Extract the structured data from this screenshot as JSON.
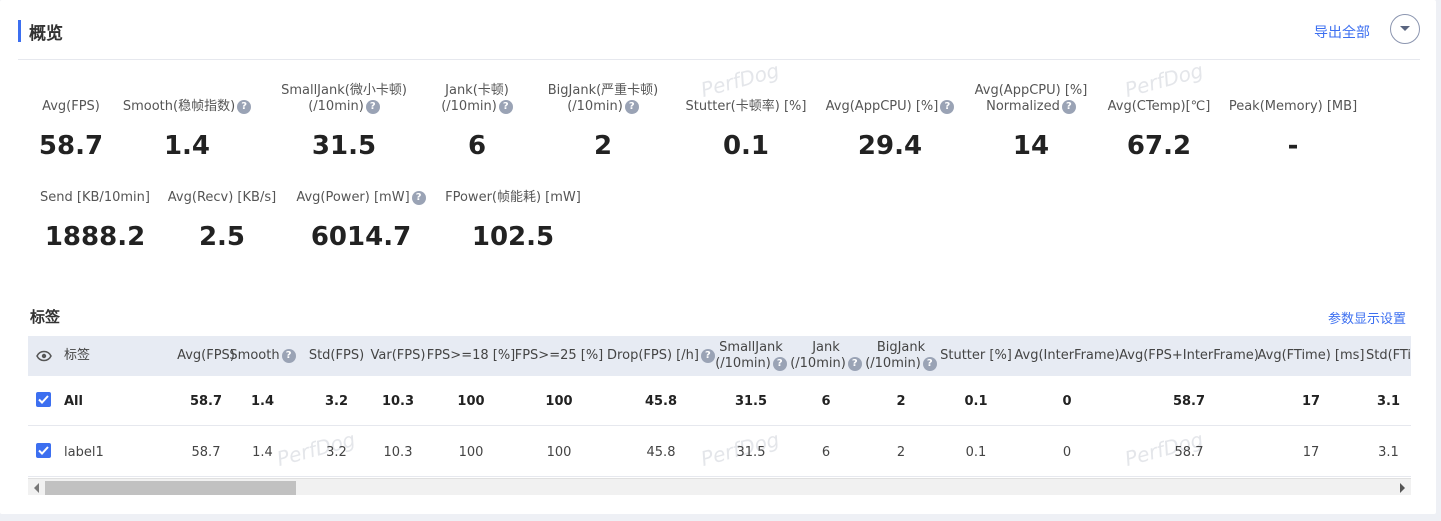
{
  "header": {
    "title": "概览",
    "export_label": "导出全部",
    "collapse_icon": "chevron-down-icon"
  },
  "watermark": "PerfDog",
  "metrics_row1": [
    {
      "l1": "",
      "l2": "Avg(FPS)",
      "help": false,
      "value": "58.7"
    },
    {
      "l1": "",
      "l2": "Smooth(稳帧指数)",
      "help": true,
      "value": "1.4"
    },
    {
      "l1": "SmallJank(微小卡顿)",
      "l2": "(/10min)",
      "help": true,
      "value": "31.5"
    },
    {
      "l1": "Jank(卡顿)",
      "l2": "(/10min)",
      "help": true,
      "value": "6"
    },
    {
      "l1": "BigJank(严重卡顿)",
      "l2": "(/10min)",
      "help": true,
      "value": "2"
    },
    {
      "l1": "",
      "l2": "Stutter(卡顿率) [%]",
      "help": false,
      "value": "0.1"
    },
    {
      "l1": "",
      "l2": "Avg(AppCPU) [%]",
      "help": true,
      "value": "29.4"
    },
    {
      "l1": "Avg(AppCPU) [%]",
      "l2": "Normalized",
      "help": true,
      "value": "14"
    },
    {
      "l1": "",
      "l2": "Avg(CTemp)[℃]",
      "help": false,
      "value": "67.2"
    },
    {
      "l1": "",
      "l2": "Peak(Memory) [MB]",
      "help": false,
      "value": "-"
    }
  ],
  "metrics_row2": [
    {
      "l1": "",
      "l2": "Send [KB/10min]",
      "help": false,
      "value": "1888.2"
    },
    {
      "l1": "",
      "l2": "Avg(Recv) [KB/s]",
      "help": false,
      "value": "2.5"
    },
    {
      "l1": "",
      "l2": "Avg(Power) [mW]",
      "help": true,
      "value": "6014.7"
    },
    {
      "l1": "",
      "l2": "FPower(帧能耗) [mW]",
      "help": false,
      "value": "102.5"
    }
  ],
  "labels_section": {
    "title": "标签",
    "settings_label": "参数显示设置"
  },
  "table": {
    "columns": [
      {
        "l1": "标签",
        "l2": "",
        "help": false
      },
      {
        "l1": "Avg(FPS)",
        "l2": "",
        "help": false
      },
      {
        "l1": "Smooth",
        "l2": "",
        "help": true
      },
      {
        "l1": "Std(FPS)",
        "l2": "",
        "help": false
      },
      {
        "l1": "Var(FPS)",
        "l2": "",
        "help": false
      },
      {
        "l1": "FPS>=18 [%]",
        "l2": "",
        "help": false
      },
      {
        "l1": "FPS>=25 [%]",
        "l2": "",
        "help": false
      },
      {
        "l1": "Drop(FPS) [/h]",
        "l2": "",
        "help": true
      },
      {
        "l1": "SmallJank",
        "l2": "(/10min)",
        "help": true
      },
      {
        "l1": "Jank",
        "l2": "(/10min)",
        "help": true
      },
      {
        "l1": "BigJank",
        "l2": "(/10min)",
        "help": true
      },
      {
        "l1": "Stutter [%]",
        "l2": "",
        "help": false
      },
      {
        "l1": "Avg(InterFrame)",
        "l2": "",
        "help": false
      },
      {
        "l1": "Avg(FPS+InterFrame)",
        "l2": "",
        "help": false
      },
      {
        "l1": "Avg(FTime) [ms]",
        "l2": "",
        "help": false
      },
      {
        "l1": "Std(FTi",
        "l2": "",
        "help": false
      }
    ],
    "rows": [
      {
        "name": "All",
        "checked": true,
        "bold": true,
        "cells": [
          "58.7",
          "1.4",
          "3.2",
          "10.3",
          "100",
          "100",
          "45.8",
          "31.5",
          "6",
          "2",
          "0.1",
          "0",
          "58.7",
          "17",
          "3.1"
        ]
      },
      {
        "name": "label1",
        "checked": true,
        "bold": false,
        "cells": [
          "58.7",
          "1.4",
          "3.2",
          "10.3",
          "100",
          "100",
          "45.8",
          "31.5",
          "6",
          "2",
          "0.1",
          "0",
          "58.7",
          "17",
          "3.1"
        ]
      }
    ]
  }
}
